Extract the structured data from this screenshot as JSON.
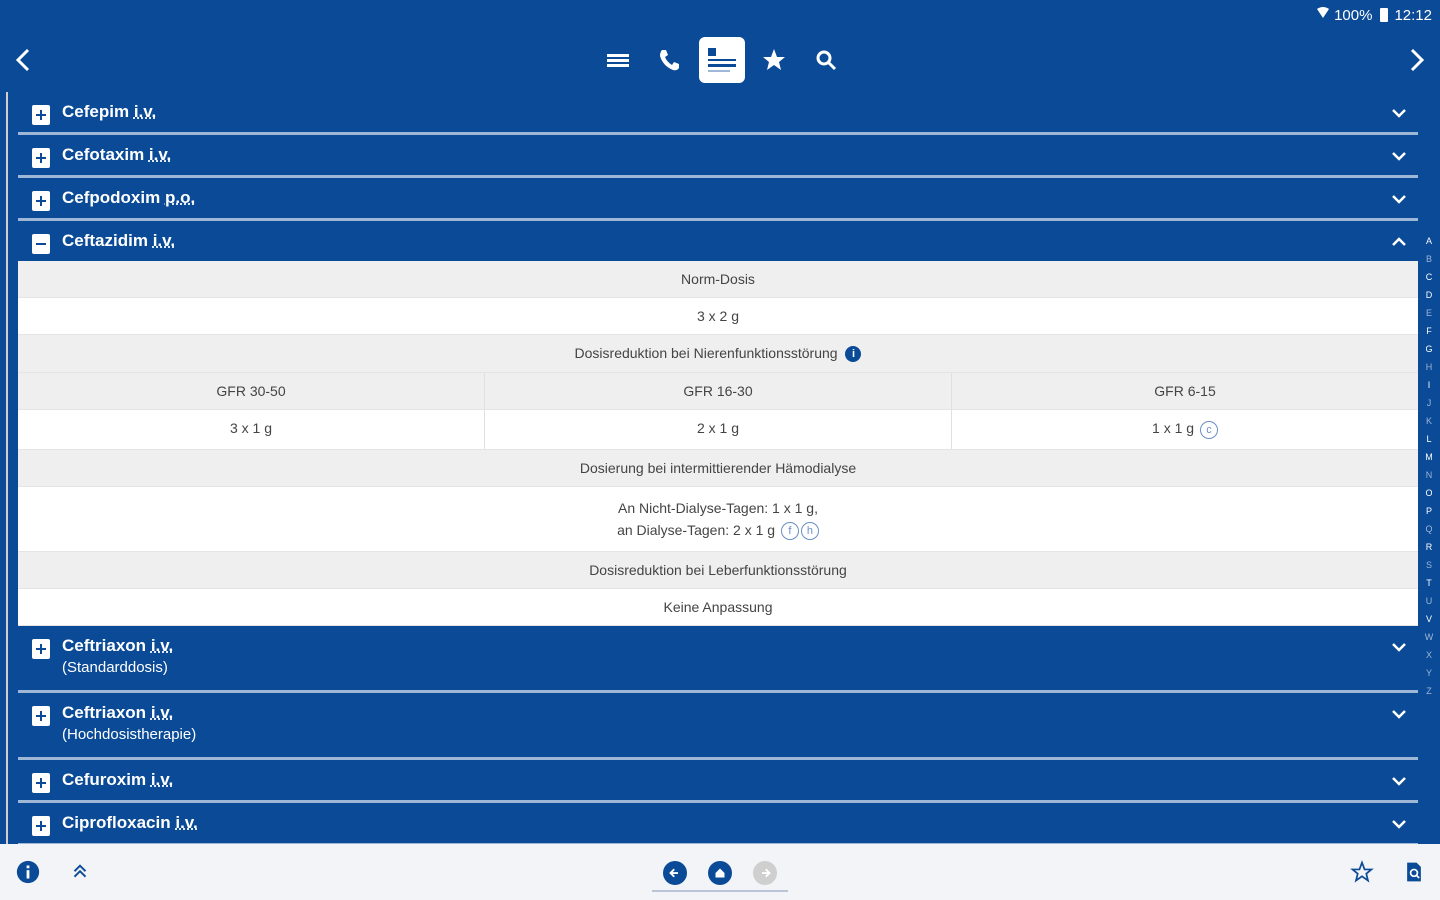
{
  "status": {
    "battery": "100%",
    "time": "12:12"
  },
  "drugs": [
    {
      "name": "Cefepim",
      "route": "i.v.",
      "sub": ""
    },
    {
      "name": "Cefotaxim",
      "route": "i.v.",
      "sub": ""
    },
    {
      "name": "Cefpodoxim",
      "route": "p.o.",
      "sub": ""
    },
    {
      "name": "Ceftazidim",
      "route": "i.v.",
      "sub": ""
    },
    {
      "name": "Ceftriaxon",
      "route": "i.v.",
      "sub": "(Standarddosis)"
    },
    {
      "name": "Ceftriaxon",
      "route": "i.v.",
      "sub": "(Hochdosistherapie)"
    },
    {
      "name": "Cefuroxim",
      "route": "i.v.",
      "sub": ""
    },
    {
      "name": "Ciprofloxacin",
      "route": "i.v.",
      "sub": ""
    }
  ],
  "detail": {
    "norm_label": "Norm-Dosis",
    "norm_value": "3 x 2 g",
    "renal_label": "Dosisreduktion bei Nierenfunktionsstörung",
    "renal_info": "i",
    "gfr_headers": [
      "GFR 30-50",
      "GFR 16-30",
      "GFR 6-15"
    ],
    "gfr_values": [
      "3 x 1 g",
      "2 x 1 g",
      "1 x 1 g"
    ],
    "gfr_note": "c",
    "dialysis_label": "Dosierung bei intermittierender Hämodialyse",
    "dialysis_line1": "An Nicht-Dialyse-Tagen: 1 x 1 g,",
    "dialysis_line2": "an Dialyse-Tagen: 2 x 1 g",
    "dialysis_notes": [
      "f",
      "h"
    ],
    "liver_label": "Dosisreduktion bei Leberfunktionsstörung",
    "liver_value": "Keine Anpassung"
  },
  "index_letters": [
    "A",
    "B",
    "C",
    "D",
    "E",
    "F",
    "G",
    "H",
    "I",
    "J",
    "K",
    "L",
    "M",
    "N",
    "O",
    "P",
    "Q",
    "R",
    "S",
    "T",
    "U",
    "V",
    "W",
    "X",
    "Y",
    "Z"
  ]
}
